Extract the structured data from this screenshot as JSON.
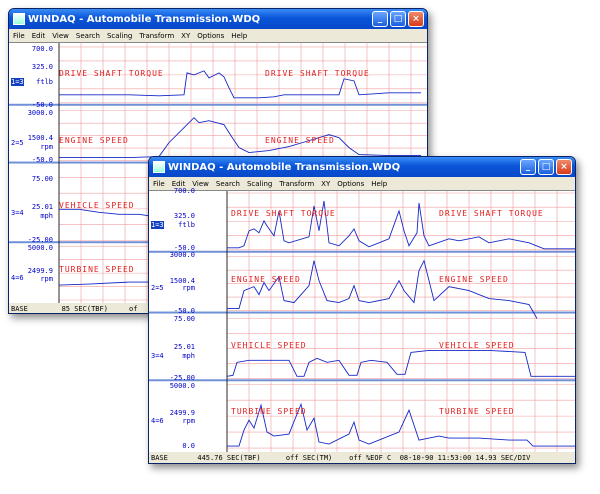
{
  "window_back": {
    "title": "WINDAQ - Automobile Transmission.WDQ",
    "menu": [
      "File",
      "Edit",
      "View",
      "Search",
      "Scaling",
      "Transform",
      "XY",
      "Options",
      "Help"
    ],
    "channels": [
      {
        "index": "1=3",
        "name": "DRIVE SHAFT TORQUE",
        "name2": "DRIVE SHAFT TORQUE",
        "top": "700.0",
        "mid": "325.0",
        "unit": "ftlb",
        "bottom": "-50.0"
      },
      {
        "index": "2=5",
        "name": "ENGINE SPEED",
        "name2": "ENGINE SPEED",
        "top": "3000.0",
        "mid": "1500.4",
        "unit": "rpm",
        "bottom": "-50.0"
      },
      {
        "index": "3=4",
        "name": "VEHICLE SPEED",
        "top": "75.00",
        "mid": "25.01",
        "unit": "mph",
        "bottom": "-25.00"
      },
      {
        "index": "4=6",
        "name": "TURBINE SPEED",
        "top": "5000.0",
        "mid": "2499.9",
        "unit": "rpm",
        "bottom": ""
      }
    ],
    "status": {
      "base": "BASE",
      "time": "85 SEC(TBF)",
      "extra": "of"
    }
  },
  "window_front": {
    "title": "WINDAQ - Automobile Transmission.WDQ",
    "menu": [
      "File",
      "Edit",
      "View",
      "Search",
      "Scaling",
      "Transform",
      "XY",
      "Options",
      "Help"
    ],
    "channels": [
      {
        "index": "1=3",
        "name": "DRIVE SHAFT TORQUE",
        "name2": "DRIVE SHAFT TORQUE",
        "top": "700.0",
        "mid": "325.0",
        "unit": "ftlb",
        "bottom": "-50.0"
      },
      {
        "index": "2=5",
        "name": "ENGINE SPEED",
        "name2": "ENGINE SPEED",
        "top": "3000.0",
        "mid": "1500.4",
        "unit": "rpm",
        "bottom": "-50.0"
      },
      {
        "index": "3=4",
        "name": "VEHICLE SPEED",
        "name2": "VEHICLE SPEED",
        "top": "75.00",
        "mid": "25.01",
        "unit": "mph",
        "bottom": "-25.00"
      },
      {
        "index": "4=6",
        "name": "TURBINE SPEED",
        "name2": "TURBINE SPEED",
        "top": "5000.0",
        "mid": "2499.9",
        "unit": "rpm",
        "bottom": "0.0"
      }
    ],
    "status": {
      "base": "BASE",
      "time": "445.76 SEC(TBF)",
      "tm": "off SEC(TM)",
      "eof": "off %EOF C",
      "date": "08-10-90 11:53:00 14.93 SEC/DIV"
    }
  },
  "colors": {
    "trace": "#1428c8",
    "grid": "#f0a0a0",
    "label": "#e02020",
    "titlebar": "#0a55d8"
  }
}
